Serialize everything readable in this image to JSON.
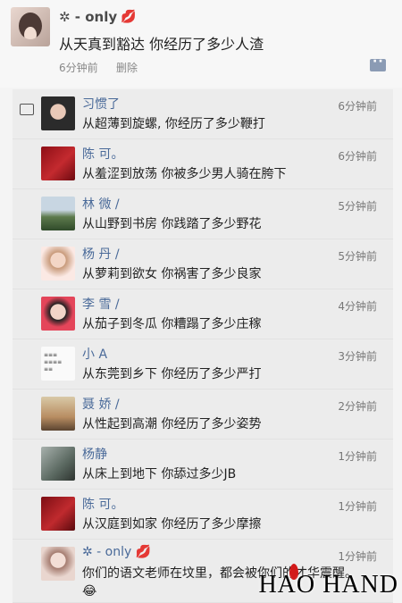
{
  "post": {
    "username": "✲ - only",
    "content": "从天真到豁达 你经历了多少人渣",
    "time": "6分钟前",
    "delete_label": "删除"
  },
  "comments": [
    {
      "name": "习惯了",
      "text": "从超薄到旋螺, 你经历了多少鞭打",
      "time": "6分钟前"
    },
    {
      "name": "陈 可。",
      "text": "从羞涩到放荡 你被多少男人骑在胯下",
      "time": "6分钟前"
    },
    {
      "name": "林 微 /",
      "text": "从山野到书房 你践踏了多少野花",
      "time": "5分钟前"
    },
    {
      "name": "杨 丹 /",
      "text": "从萝莉到欲女 你祸害了多少良家",
      "time": "5分钟前"
    },
    {
      "name": "李 雪 /",
      "text": "从茄子到冬瓜 你糟蹋了多少庄稼",
      "time": "4分钟前"
    },
    {
      "name": "小 A",
      "text": "从东莞到乡下 你经历了多少严打",
      "time": "3分钟前"
    },
    {
      "name": "聂 娇 /",
      "text": "从性起到高潮 你经历了多少姿势",
      "time": "2分钟前"
    },
    {
      "name": "杨静",
      "text": "从床上到地下 你舔过多少JB",
      "time": "1分钟前"
    },
    {
      "name": "陈 可。",
      "text": "从汉庭到如家 你经历了多少摩擦",
      "time": "1分钟前"
    },
    {
      "name": "✲ - only",
      "text": "你们的语文老师在坟里，都会被你们的才华震醒。😂",
      "time": "1分钟前"
    }
  ],
  "watermark": "HAO HAND",
  "colors": {
    "name_link": "#4a6a99",
    "accent_lips": "#c0102a"
  }
}
